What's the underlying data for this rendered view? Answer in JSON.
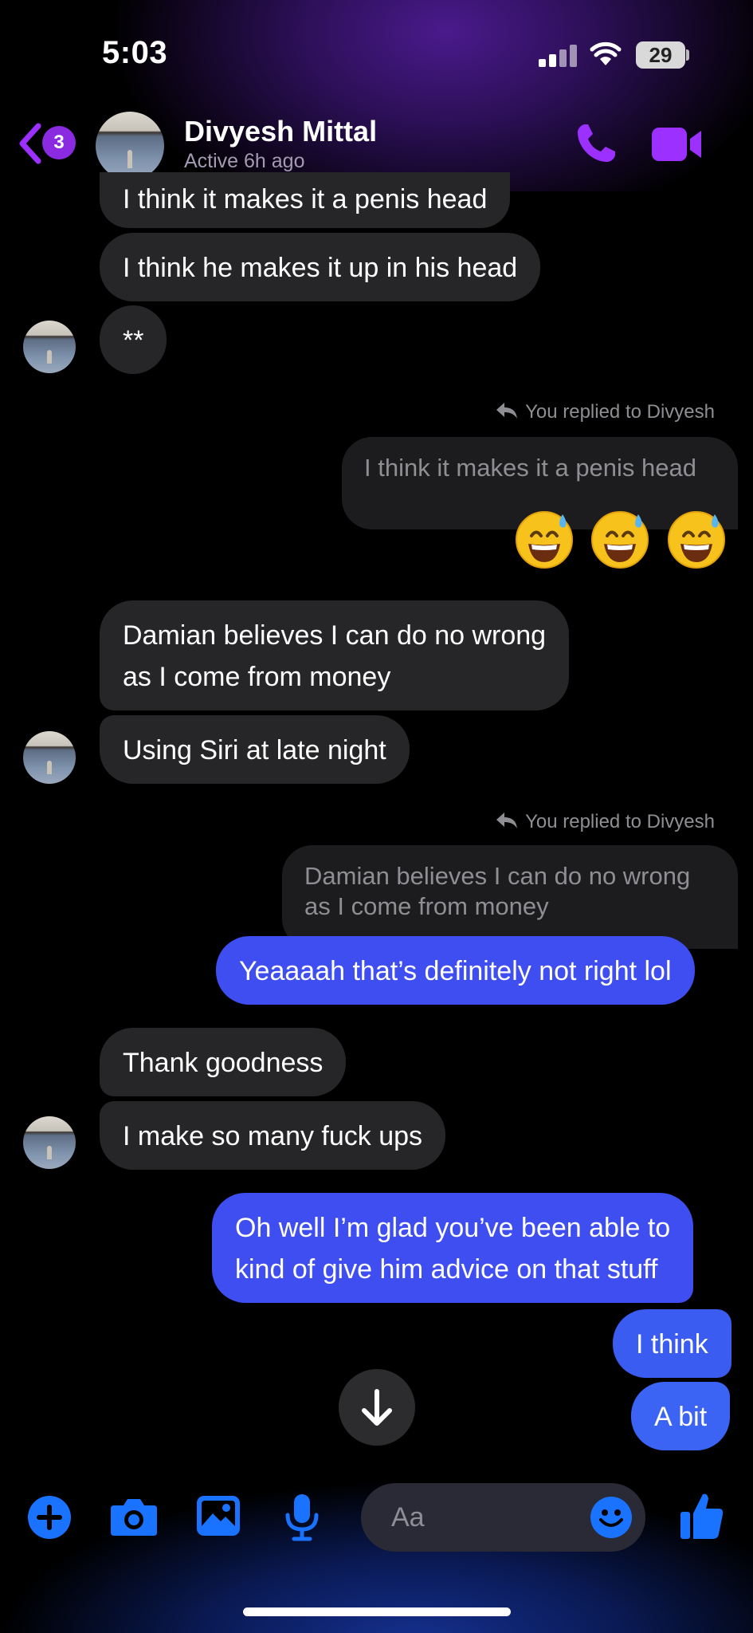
{
  "status_bar": {
    "time": "5:03",
    "battery": "29"
  },
  "header": {
    "unread_count": "3",
    "contact_name": "Divyesh Mittal",
    "contact_status": "Active 6h ago"
  },
  "messages": {
    "m1": "I think it makes it a penis head",
    "m2": "I think he makes it up in his head",
    "m3": "**",
    "reply1_note": "You replied to Divyesh",
    "reply1_quote": "I think it makes it a penis head",
    "m4_line1": "Damian believes I can do no wrong",
    "m4_line2": "as I come from money",
    "m5": "Using Siri at late night",
    "reply2_note": "You replied to Divyesh",
    "reply2_quote_line1": "Damian believes I can do no wrong",
    "reply2_quote_line2": "as I come from money",
    "m6": "Yeaaaah that’s definitely not right lol",
    "m7": "Thank goodness",
    "m8": "I make so many fuck ups",
    "m9_line1": "Oh well I’m glad you’ve been able to",
    "m9_line2": "kind of give him advice on that stuff",
    "m10": "I think",
    "m11": "A bit"
  },
  "reply1_reactions": [
    "grinning-face-with-sweat",
    "grinning-face-with-sweat",
    "grinning-face-with-sweat"
  ],
  "composer": {
    "placeholder": "Aa"
  },
  "colors": {
    "accent_purple": "#9b30ff",
    "outgoing_bubble": "#3b64f5",
    "incoming_bubble": "#262628",
    "composer_blue": "#1a73ff"
  },
  "icons": [
    "back-chevron-icon",
    "phone-icon",
    "video-camera-icon",
    "reply-arrow-icon",
    "arrow-down-icon",
    "plus-icon",
    "camera-icon",
    "photo-icon",
    "microphone-icon",
    "emoji-icon",
    "thumbs-up-icon"
  ]
}
